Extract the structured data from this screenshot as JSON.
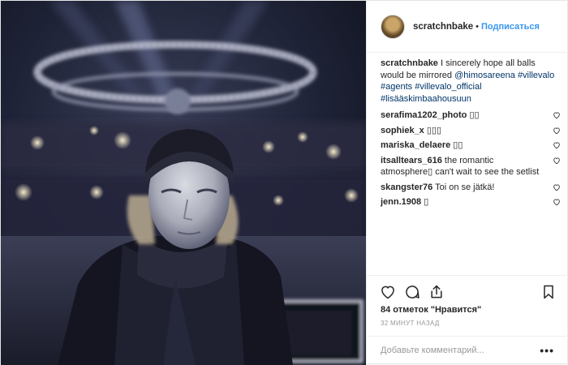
{
  "post": {
    "username": "scratchnbake",
    "separator": "•",
    "follow_label": "Подписаться"
  },
  "caption": {
    "username": "scratchnbake",
    "text": "I sincerely hope all balls would be mirrored",
    "mention": "@himosareena",
    "tags": [
      "#villevalo",
      "#agents",
      "#villevalo_official",
      "#lisääskimbaahousuun"
    ]
  },
  "comments": [
    {
      "username": "serafima1202_photo",
      "text": "▯▯"
    },
    {
      "username": "sophiek_x",
      "text": "▯▯▯"
    },
    {
      "username": "mariska_delaere",
      "text": "▯▯"
    },
    {
      "username": "itsalltears_616",
      "text": "the romantic atmosphere▯ can't wait to see the setlist"
    },
    {
      "username": "skangster76",
      "text": "Toi on se jätkä!"
    },
    {
      "username": "jenn.1908",
      "text": "▯"
    }
  ],
  "likes": "84 отметок \"Нравится\"",
  "timestamp": "32 минут назад",
  "add_comment": {
    "placeholder": "Добавьте комментарий..."
  },
  "more_label": "•••",
  "icons": {
    "like": "heart-icon",
    "comment": "comment-icon",
    "share": "share-icon",
    "save": "bookmark-icon",
    "comment_like": "heart-icon"
  },
  "colors": {
    "link": "#003569",
    "follow": "#3897f0",
    "text": "#262626",
    "muted": "#999999",
    "border": "#efefef"
  }
}
